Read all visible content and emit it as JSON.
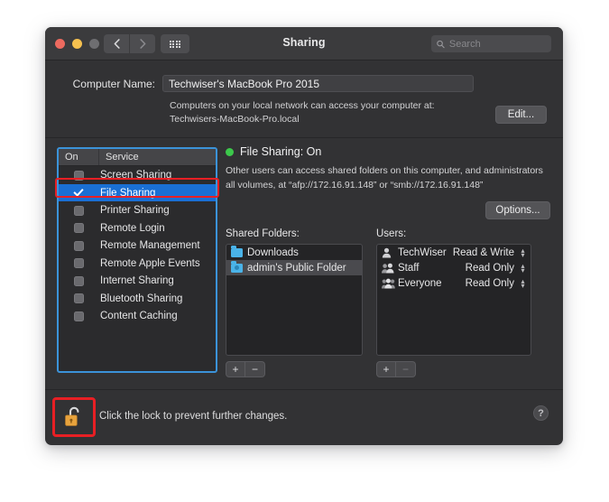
{
  "window": {
    "title": "Sharing",
    "traffic_lights": [
      "close",
      "minimize",
      "zoom"
    ],
    "nav_back_icon": "chevron-left-icon",
    "nav_forward_icon": "chevron-right-icon",
    "grid_icon": "grid-view-icon",
    "search": {
      "placeholder": "Search",
      "value": "",
      "icon": "search-icon"
    }
  },
  "computer_name": {
    "label": "Computer Name:",
    "value": "Techwiser's MacBook Pro 2015",
    "info_line1": "Computers on your local network can access your computer at:",
    "info_line2": "Techwisers-MacBook-Pro.local",
    "edit_label": "Edit..."
  },
  "services": {
    "header_on": "On",
    "header_service": "Service",
    "items": [
      {
        "name": "Screen Sharing",
        "on": false,
        "selected": false
      },
      {
        "name": "File Sharing",
        "on": true,
        "selected": true
      },
      {
        "name": "Printer Sharing",
        "on": false,
        "selected": false
      },
      {
        "name": "Remote Login",
        "on": false,
        "selected": false
      },
      {
        "name": "Remote Management",
        "on": false,
        "selected": false
      },
      {
        "name": "Remote Apple Events",
        "on": false,
        "selected": false
      },
      {
        "name": "Internet Sharing",
        "on": false,
        "selected": false
      },
      {
        "name": "Bluetooth Sharing",
        "on": false,
        "selected": false
      },
      {
        "name": "Content Caching",
        "on": false,
        "selected": false
      }
    ]
  },
  "detail": {
    "status_title": "File Sharing: On",
    "status_color": "#3cc84b",
    "description_line1": "Other users can access shared folders on this computer, and administrators",
    "description_line2": "all volumes, at “afp://172.16.91.148” or “smb://172.16.91.148”",
    "options_label": "Options...",
    "shared_folders_label": "Shared Folders:",
    "users_label": "Users:",
    "shared_folders": [
      {
        "name": "Downloads",
        "icon": "folder-icon",
        "selected": false
      },
      {
        "name": "admin's Public Folder",
        "icon": "public-folder-icon",
        "selected": true
      }
    ],
    "users": [
      {
        "name": "TechWiser",
        "permission": "Read & Write",
        "icon": "single-user-icon"
      },
      {
        "name": "Staff",
        "permission": "Read Only",
        "icon": "group-users-icon"
      },
      {
        "name": "Everyone",
        "permission": "Read Only",
        "icon": "everyone-users-icon"
      }
    ],
    "folders_add_label": "+",
    "folders_remove_label": "−",
    "users_add_label": "+",
    "users_remove_label": "−"
  },
  "footer": {
    "lock_icon": "unlocked-padlock-icon",
    "lock_text": "Click the lock to prevent further changes.",
    "help_label": "?"
  },
  "annotations": {
    "service_list_border_color": "#3b93d9",
    "file_sharing_box_color": "#e81f24",
    "lock_box_color": "#e81f24"
  }
}
